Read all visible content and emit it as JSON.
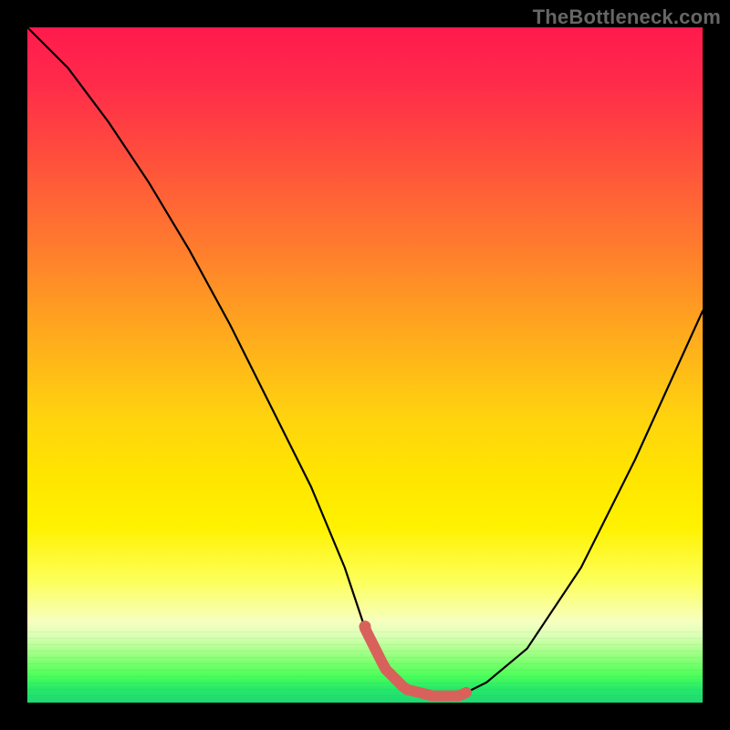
{
  "watermark": {
    "text": "TheBottleneck.com"
  },
  "chart_data": {
    "type": "line",
    "title": "",
    "xlabel": "",
    "ylabel": "",
    "xlim": [
      0,
      100
    ],
    "ylim": [
      0,
      100
    ],
    "grid": false,
    "legend": false,
    "background": {
      "stops": [
        {
          "pos": 0,
          "color": "#ff1a4d"
        },
        {
          "pos": 50,
          "color": "#ffd400"
        },
        {
          "pos": 88,
          "color": "#f6ffc0"
        },
        {
          "pos": 100,
          "color": "#1fd873"
        }
      ]
    },
    "series": [
      {
        "name": "bottleneck-curve",
        "color": "#000000",
        "x": [
          0,
          6,
          12,
          18,
          24,
          30,
          36,
          42,
          47,
          50,
          53,
          56,
          60,
          64,
          68,
          74,
          82,
          90,
          100
        ],
        "y": [
          100,
          94,
          86,
          77,
          67,
          56,
          44,
          32,
          20,
          11,
          5,
          2,
          1,
          1,
          3,
          8,
          20,
          36,
          58
        ]
      }
    ],
    "annotations": [
      {
        "name": "min-band",
        "type": "band",
        "color": "#d9615b",
        "x_range": [
          50,
          65
        ],
        "y_approx": 1
      }
    ]
  }
}
